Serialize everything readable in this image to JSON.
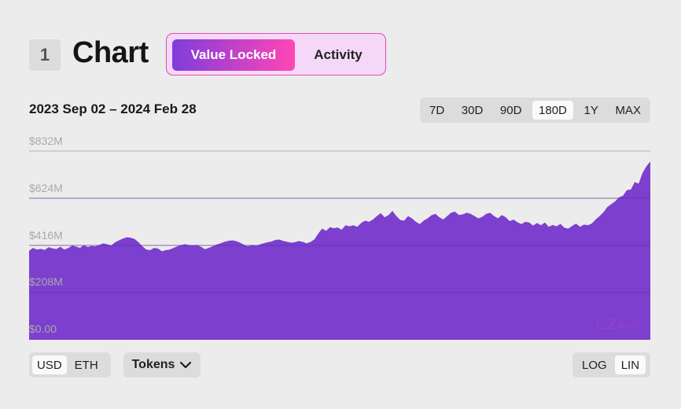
{
  "header": {
    "step_number": "1",
    "title": "Chart",
    "tabs": {
      "active": "Value Locked",
      "inactive": "Activity"
    }
  },
  "date_range": "2023 Sep 02 – 2024 Feb 28",
  "range_buttons": [
    "7D",
    "30D",
    "90D",
    "180D",
    "1Y",
    "MAX"
  ],
  "range_selected": "180D",
  "unit_buttons": [
    "USD",
    "ETH"
  ],
  "unit_selected": "USD",
  "tokens_button": "Tokens",
  "scale_buttons": [
    "LOG",
    "LIN"
  ],
  "scale_selected": "LIN",
  "watermark": "L2BEAT",
  "colors": {
    "area": "#7c3fce",
    "accent_start": "#7f3ddb",
    "accent_end": "#ff46b5",
    "gridline": "#b4b4b4"
  },
  "chart_data": {
    "type": "area",
    "x_range": [
      "2023 Sep 02",
      "2024 Feb 28"
    ],
    "y_ticks": [
      "$832M",
      "$624M",
      "$416M",
      "$208M",
      "$0.00"
    ],
    "ylim": [
      0,
      832
    ],
    "y_unit": "$M",
    "grid": true,
    "values": [
      392,
      405,
      398,
      401,
      396,
      408,
      403,
      400,
      410,
      398,
      404,
      415,
      411,
      405,
      417,
      409,
      414,
      412,
      418,
      425,
      421,
      415,
      430,
      438,
      446,
      452,
      450,
      444,
      430,
      412,
      398,
      395,
      405,
      402,
      390,
      395,
      398,
      405,
      412,
      418,
      421,
      417,
      416,
      418,
      410,
      399,
      405,
      412,
      420,
      425,
      432,
      436,
      438,
      435,
      428,
      419,
      412,
      418,
      414,
      420,
      425,
      430,
      433,
      440,
      442,
      436,
      432,
      428,
      430,
      435,
      432,
      425,
      431,
      442,
      468,
      490,
      480,
      496,
      492,
      495,
      485,
      505,
      500,
      505,
      498,
      515,
      525,
      520,
      530,
      545,
      558,
      540,
      550,
      568,
      545,
      528,
      525,
      545,
      535,
      520,
      510,
      525,
      535,
      549,
      555,
      540,
      530,
      545,
      560,
      565,
      550,
      553,
      560,
      555,
      545,
      535,
      542,
      555,
      560,
      545,
      535,
      550,
      540,
      523,
      530,
      518,
      510,
      520,
      517,
      503,
      515,
      505,
      517,
      498,
      506,
      500,
      511,
      494,
      490,
      502,
      512,
      498,
      508,
      505,
      512,
      530,
      545,
      562,
      585,
      598,
      610,
      628,
      635,
      660,
      662,
      695,
      688,
      735,
      765,
      786
    ]
  }
}
